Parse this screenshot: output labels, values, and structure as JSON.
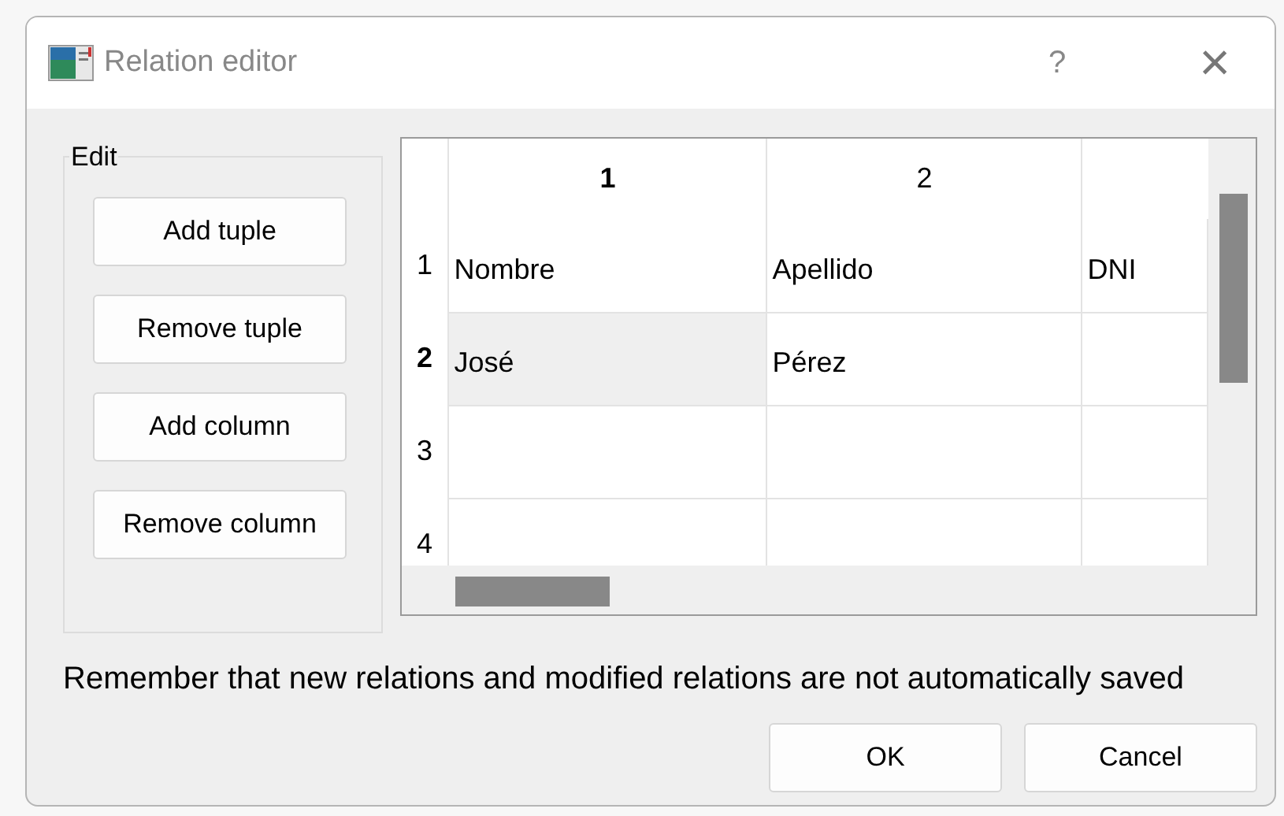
{
  "window": {
    "title": "Relation editor",
    "help": "?",
    "close": "×"
  },
  "edit_group": {
    "title": "Edit",
    "buttons": [
      "Add tuple",
      "Remove tuple",
      "Add column",
      "Remove column"
    ]
  },
  "table": {
    "columns": [
      {
        "label": "1",
        "selected": true
      },
      {
        "label": "2",
        "selected": false
      }
    ],
    "rows": [
      {
        "label": "1",
        "selected": false,
        "cells": [
          {
            "text": "Nombre",
            "selected": false
          },
          {
            "text": "Apellido",
            "selected": false
          },
          {
            "text": "DNI",
            "selected": false
          }
        ]
      },
      {
        "label": "2",
        "selected": true,
        "cells": [
          {
            "text": "José",
            "selected": true
          },
          {
            "text": "Pérez",
            "selected": false
          },
          {
            "text": "",
            "selected": false
          }
        ]
      },
      {
        "label": "3",
        "selected": false,
        "cells": [
          {
            "text": "",
            "selected": false
          },
          {
            "text": "",
            "selected": false
          },
          {
            "text": "",
            "selected": false
          }
        ]
      },
      {
        "label": "4",
        "selected": false,
        "cells": [
          {
            "text": "",
            "selected": false
          },
          {
            "text": "",
            "selected": false
          },
          {
            "text": "",
            "selected": false
          }
        ]
      }
    ]
  },
  "message": "Remember that new relations and modified relations are not automatically saved",
  "buttons": [
    "OK",
    "Cancel"
  ]
}
